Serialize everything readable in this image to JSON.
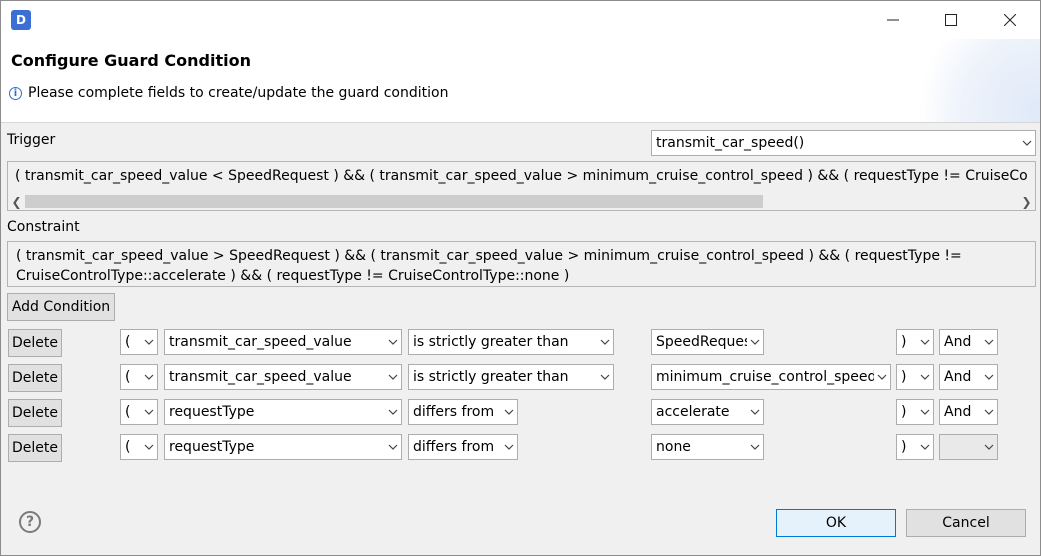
{
  "window": {
    "app_icon": "D",
    "minimize_glyph": "—",
    "maximize_glyph": "☐",
    "close_glyph": "✕"
  },
  "header": {
    "title": "Configure Guard Condition",
    "info": "Please complete fields to create/update the guard condition"
  },
  "trigger": {
    "label": "Trigger",
    "selected": "transmit_car_speed()",
    "text": "( transmit_car_speed_value < SpeedRequest ) && ( transmit_car_speed_value > minimum_cruise_control_speed ) && ( requestType != CruiseControlType::brake ) && ( requestType != CruiseControlType::none )"
  },
  "constraint": {
    "label": "Constraint",
    "text": "( transmit_car_speed_value > SpeedRequest ) && ( transmit_car_speed_value > minimum_cruise_control_speed ) && ( requestType != CruiseControlType::accelerate ) && ( requestType != CruiseControlType::none )"
  },
  "add_condition_label": "Add Condition",
  "conditions": [
    {
      "delete": "Delete",
      "open": "(",
      "variable": "transmit_car_speed_value",
      "operator": "is strictly greater than",
      "value": "SpeedRequest",
      "close": ")",
      "logic": "And"
    },
    {
      "delete": "Delete",
      "open": "(",
      "variable": "transmit_car_speed_value",
      "operator": "is strictly greater than",
      "value": "minimum_cruise_control_speed",
      "close": ")",
      "logic": "And"
    },
    {
      "delete": "Delete",
      "open": "(",
      "variable": "requestType",
      "operator": "differs from",
      "value": "accelerate",
      "close": ")",
      "logic": "And"
    },
    {
      "delete": "Delete",
      "open": "(",
      "variable": "requestType",
      "operator": "differs from",
      "value": "none",
      "close": ")",
      "logic": ""
    }
  ],
  "footer": {
    "help_glyph": "?",
    "ok_label": "OK",
    "cancel_label": "Cancel"
  }
}
